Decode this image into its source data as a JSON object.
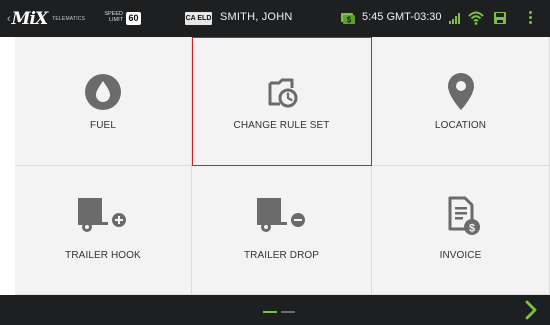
{
  "statusbar": {
    "brand_prefix": "‹",
    "brand_logo": "MiX",
    "brand_tagline": "TELEMATICS",
    "speed_label_line1": "SPEED",
    "speed_label_line2": "LIMIT",
    "speed_limit": "60",
    "eld_badge": "CA ELD",
    "driver_name": "SMITH, JOHN",
    "time": "5:45 GMT-03:30",
    "icons": [
      "money-icon",
      "signal-icon",
      "wifi-icon",
      "save-icon",
      "kebab-menu-icon"
    ]
  },
  "tiles": [
    {
      "label": "FUEL",
      "icon": "fuel-drop-icon"
    },
    {
      "label": "CHANGE RULE SET",
      "icon": "document-clock-icon",
      "selected": true
    },
    {
      "label": "LOCATION",
      "icon": "location-pin-icon"
    },
    {
      "label": "TRAILER HOOK",
      "icon": "trailer-hook-icon"
    },
    {
      "label": "TRAILER DROP",
      "icon": "trailer-drop-icon"
    },
    {
      "label": "INVOICE",
      "icon": "invoice-icon"
    }
  ],
  "pager": {
    "pages": 2,
    "current": 1
  },
  "colors": {
    "bar_background": "#1e1f21",
    "accent_green": "#7cc142",
    "selection_red": "#cf1f26",
    "icon_gray": "#6b6b6b",
    "tile_background": "#f3f3f3"
  }
}
